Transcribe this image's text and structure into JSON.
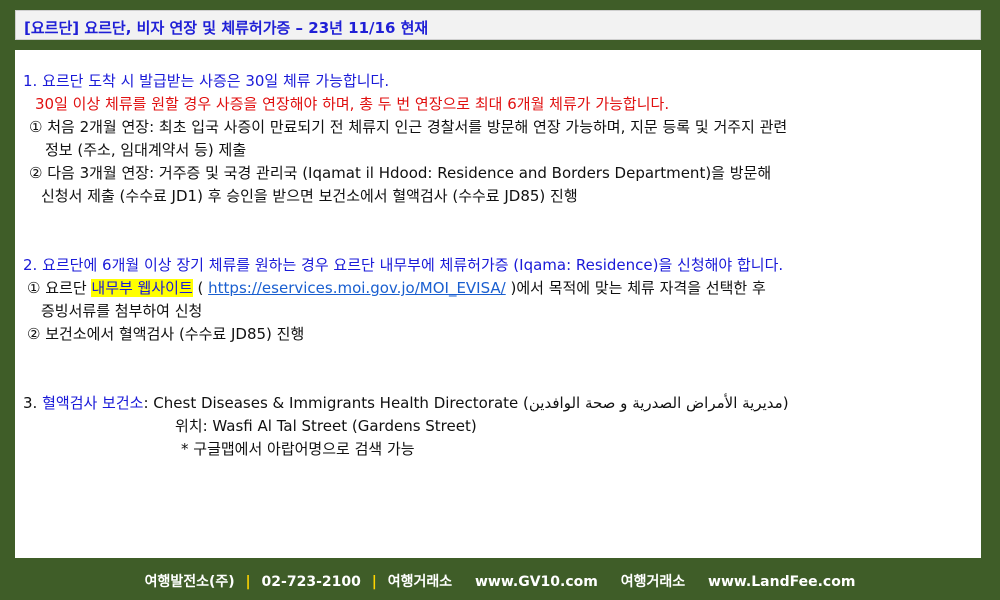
{
  "title": "[요르단] 요르단, 비자 연장 및 체류허가증 – 23년  11/16 현재",
  "section1": {
    "heading": "1. 요르단 도착 시 발급받는 사증은 30일 체류 가능합니다.",
    "warning": "30일 이상 체류를 원할 경우 사증을 연장해야 하며, 총 두 번 연장으로 최대 6개월 체류가 가능합니다.",
    "item1_line1": "① 처음 2개월 연장: 최초 입국 사증이 만료되기 전 체류지 인근 경찰서를 방문해 연장 가능하며, 지문 등록 및 거주지 관련",
    "item1_line2": "정보 (주소, 임대계약서 등) 제출",
    "item2_line1": "② 다음 3개월 연장: 거주증 및 국경 관리국 (Iqamat il Hdood: Residence and Borders Department)을 방문해",
    "item2_line2": "신청서 제출 (수수료 JD1) 후 승인을 받으면 보건소에서 혈액검사 (수수료 JD85) 진행"
  },
  "section2": {
    "heading": "2. 요르단에 6개월 이상 장기 체류를 원하는 경우 요르단 내무부에 체류허가증 (Iqama: Residence)을 신청해야 합니다.",
    "item1_prefix": "① 요르단 ",
    "item1_highlight": "내무부 웹사이트",
    "item1_paren_open": " ( ",
    "item1_link": "https://eservices.moi.gov.jo/MOI_EVISA/",
    "item1_suffix": " )에서 목적에 맞는 체류 자격을 선택한 후",
    "item1_line2": "증빙서류를 첨부하여 신청",
    "item2": "② 보건소에서 혈액검사 (수수료 JD85) 진행"
  },
  "section3": {
    "number": "3. ",
    "label": "혈액검사 보건소",
    "colon": ": Chest Diseases & Immigrants Health Directorate (مديرية الأمراض الصدرية و صحة الوافدين)",
    "location": "위치: Wasfi Al Tal Street (Gardens Street)",
    "note": "* 구글맵에서 아랍어명으로 검색 가능"
  },
  "footer": {
    "company": "여행발전소(주)",
    "phone": "02-723-2100",
    "label1": "여행거래소",
    "site1": "www.GV10.com",
    "label2": "여행거래소",
    "site2": "www.LandFee.com",
    "separator": "|",
    "separator_color": "#ffd400"
  },
  "colors": {
    "background": "#3f5d28",
    "heading_blue": "#1a1ad8",
    "warning_red": "#e01010",
    "highlight": "#ffff00"
  }
}
